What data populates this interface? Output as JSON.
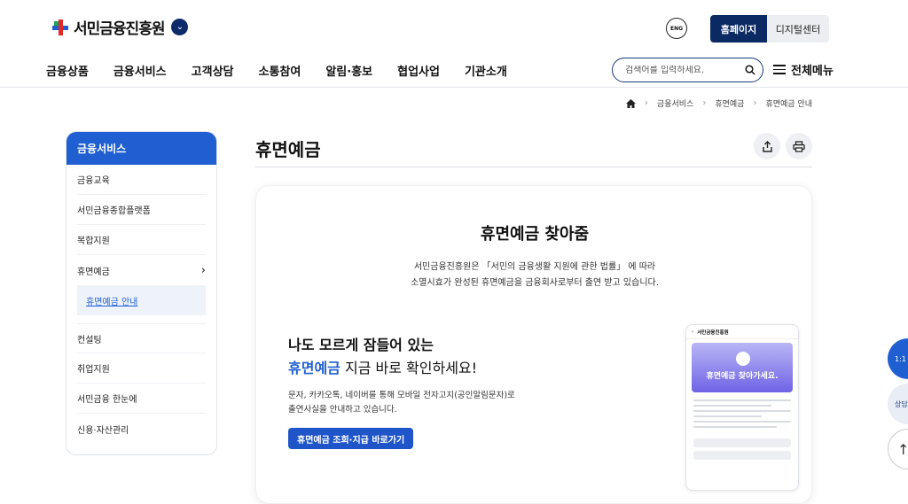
{
  "header": {
    "logo_text": "서민금융진흥원",
    "globe_label": "ENG",
    "site_tabs": [
      "홈페이지",
      "디지털센터"
    ],
    "gnb": [
      "금융상품",
      "금융서비스",
      "고객상담",
      "소통참여",
      "알림·홍보",
      "협업사업",
      "기관소개"
    ],
    "search_placeholder": "검색어를 입력하세요.",
    "all_menu": "전체메뉴"
  },
  "breadcrumb": [
    "금융서비스",
    "휴면예금",
    "휴면예금 안내"
  ],
  "sidebar": {
    "title": "금융서비스",
    "items": [
      "금융교육",
      "서민금융종합플랫폼",
      "복합지원",
      "휴면예금",
      "컨설팅",
      "취업지원",
      "서민금융 한눈에",
      "신용·자산관리"
    ],
    "sub_item": "휴면예금 안내"
  },
  "main": {
    "page_title": "휴면예금",
    "card_title": "휴면예금 찾아줌",
    "card_desc_line1": "서민금융진흥원은 「서민의 금융생활 지원에 관한 법률」 에 따라",
    "card_desc_line2": "소멸시효가 완성된 휴면예금을 금융회사로부터 출연 받고 있습니다.",
    "promo_line1": "나도 모르게 잠들어 있는",
    "promo_highlight": "휴면예금",
    "promo_line2_rest": " 지금 바로 확인하세요!",
    "promo_desc_line1": "문자, 카카오톡, 네이버를 통해 모바일 전자고지(공인알림문자)로",
    "promo_desc_line2": "출연사실을 안내하고 있습니다.",
    "cta": "휴면예금 조회·지급 바로가기",
    "phone_header": "서민금융진흥원",
    "phone_banner": "휴면예금 찾아가세요."
  },
  "floating": [
    "1:1",
    "상담",
    "↑"
  ],
  "colors": {
    "primary": "#1f5fd1",
    "navy": "#0b2a63"
  }
}
